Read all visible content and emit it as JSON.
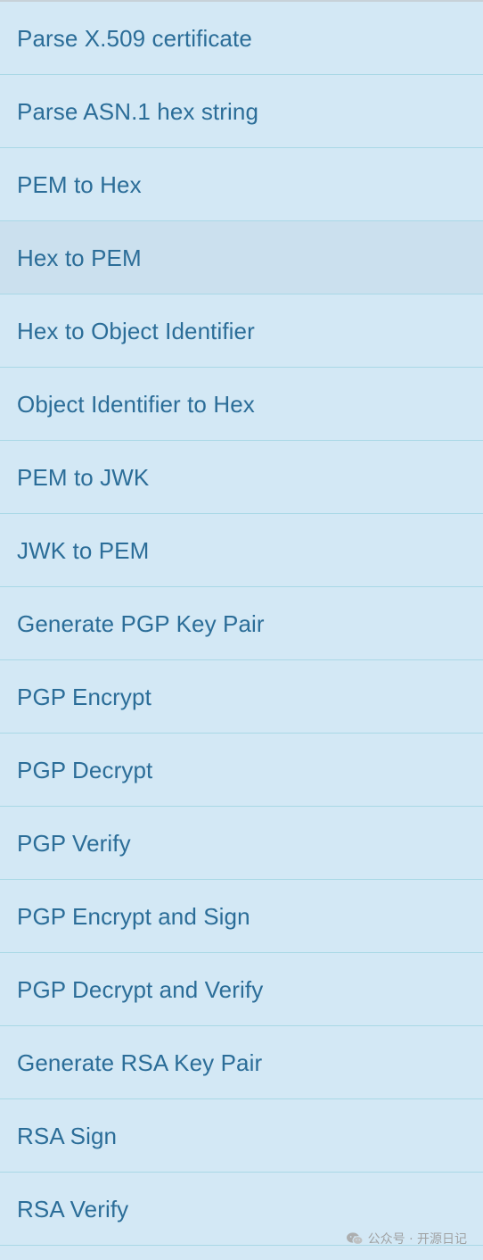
{
  "operations": [
    {
      "label": "Parse X.509 certificate"
    },
    {
      "label": "Parse ASN.1 hex string"
    },
    {
      "label": "PEM to Hex"
    },
    {
      "label": "Hex to PEM"
    },
    {
      "label": "Hex to Object Identifier"
    },
    {
      "label": "Object Identifier to Hex"
    },
    {
      "label": "PEM to JWK"
    },
    {
      "label": "JWK to PEM"
    },
    {
      "label": "Generate PGP Key Pair"
    },
    {
      "label": "PGP Encrypt"
    },
    {
      "label": "PGP Decrypt"
    },
    {
      "label": "PGP Verify"
    },
    {
      "label": "PGP Encrypt and Sign"
    },
    {
      "label": "PGP Decrypt and Verify"
    },
    {
      "label": "Generate RSA Key Pair"
    },
    {
      "label": "RSA Sign"
    },
    {
      "label": "RSA Verify"
    }
  ],
  "watermark": {
    "text": "公众号 · 开源日记",
    "icon": "wechat-icon"
  },
  "colors": {
    "background": "#d3e8f5",
    "hover_background": "#cbe0ee",
    "divider": "#a9d8e6",
    "label_text": "#2b6d98"
  }
}
